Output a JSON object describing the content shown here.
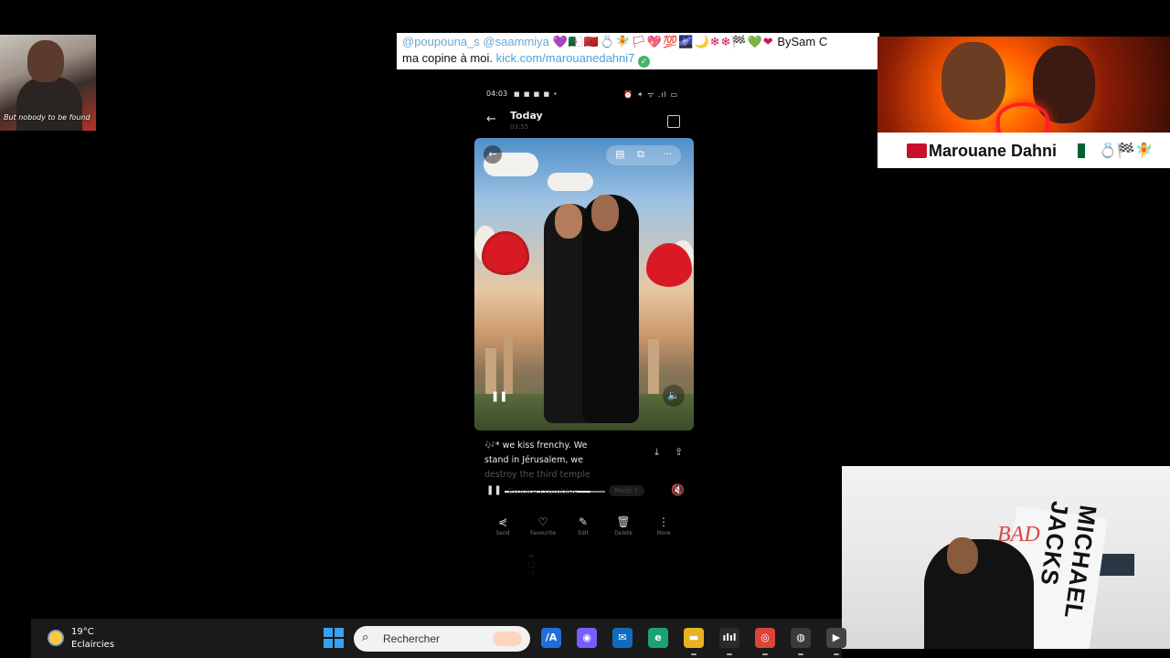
{
  "cam_top_left": {
    "caption": "But nobody to be found"
  },
  "chat_banner": {
    "mention_1": "@poupouna_s",
    "mention_2": "@saammiya",
    "emojis": "💜🇩🇿🇲🇦💍🧚🏳💖💯🌌🌙❄❄🏁💚❤",
    "author_tag": "BySam C",
    "message_text": "ma copine à moi.",
    "link_text": "kick.com/marouanedahni7",
    "verified_icon": "check-circle-icon"
  },
  "top_right_panel": {
    "name": "Marouane Dahni",
    "emojis_after": "💍🏁🧚"
  },
  "phone": {
    "status_time": "04:03",
    "status_icons": "■ ■ ■ ■ •",
    "status_right": "⏰ ✶ ᯤ .ıl ▭",
    "header_title": "Today",
    "header_subtitle": "03:55",
    "back_symbol": "←",
    "media_back_symbol": "←",
    "media_tools": [
      "▤",
      "⧉",
      "···"
    ],
    "play_symbol": "❚❚",
    "volume_symbol": "🔈",
    "caption_line_1": "🎶* we kiss frenchy. We",
    "caption_line_2": "stand in Jérusalem, we",
    "caption_line_3": "destroy the third temple",
    "caption_line_4": "Empire crumbles",
    "caption_chip": "Reels ↑",
    "download_symbol": "⤓",
    "share_symbol": "⇪",
    "mini_pause_symbol": "❚❚",
    "mini_mute_symbol": "🔇",
    "mini_progress": 0.85,
    "actions": [
      {
        "icon": "⋞",
        "label": "Send"
      },
      {
        "icon": "♡",
        "label": "Favourite"
      },
      {
        "icon": "✎",
        "label": "Edit"
      },
      {
        "icon": "🗑",
        "label": "Delete"
      },
      {
        "icon": "⋮",
        "label": "More"
      }
    ],
    "nav_hint": "≡ □ ◁"
  },
  "cam_bottom_right": {
    "album_text": "MICHAEL JACKS",
    "album_title": "BAD"
  },
  "taskbar": {
    "weather_temp": "19°C",
    "weather_condition": "Eclaircies",
    "search_placeholder": "Rechercher",
    "apps": [
      {
        "name": "ai-app-icon",
        "glyph": "/A",
        "color": "#1e6fd9"
      },
      {
        "name": "copilot-icon",
        "glyph": "◉",
        "color": "#7a5cff"
      },
      {
        "name": "outlook-icon",
        "glyph": "✉",
        "color": "#0f6cbd"
      },
      {
        "name": "edge-icon",
        "glyph": "e",
        "color": "#1aa371"
      },
      {
        "name": "file-explorer-icon",
        "glyph": "▬",
        "color": "#e8b323"
      },
      {
        "name": "audio-app-icon",
        "glyph": "ılıl",
        "color": "#2b2b2b"
      },
      {
        "name": "chrome-icon",
        "glyph": "◎",
        "color": "#db4437"
      },
      {
        "name": "obs-icon",
        "glyph": "◍",
        "color": "#3a3a3a"
      },
      {
        "name": "media-player-icon",
        "glyph": "▶",
        "color": "#444"
      }
    ]
  }
}
